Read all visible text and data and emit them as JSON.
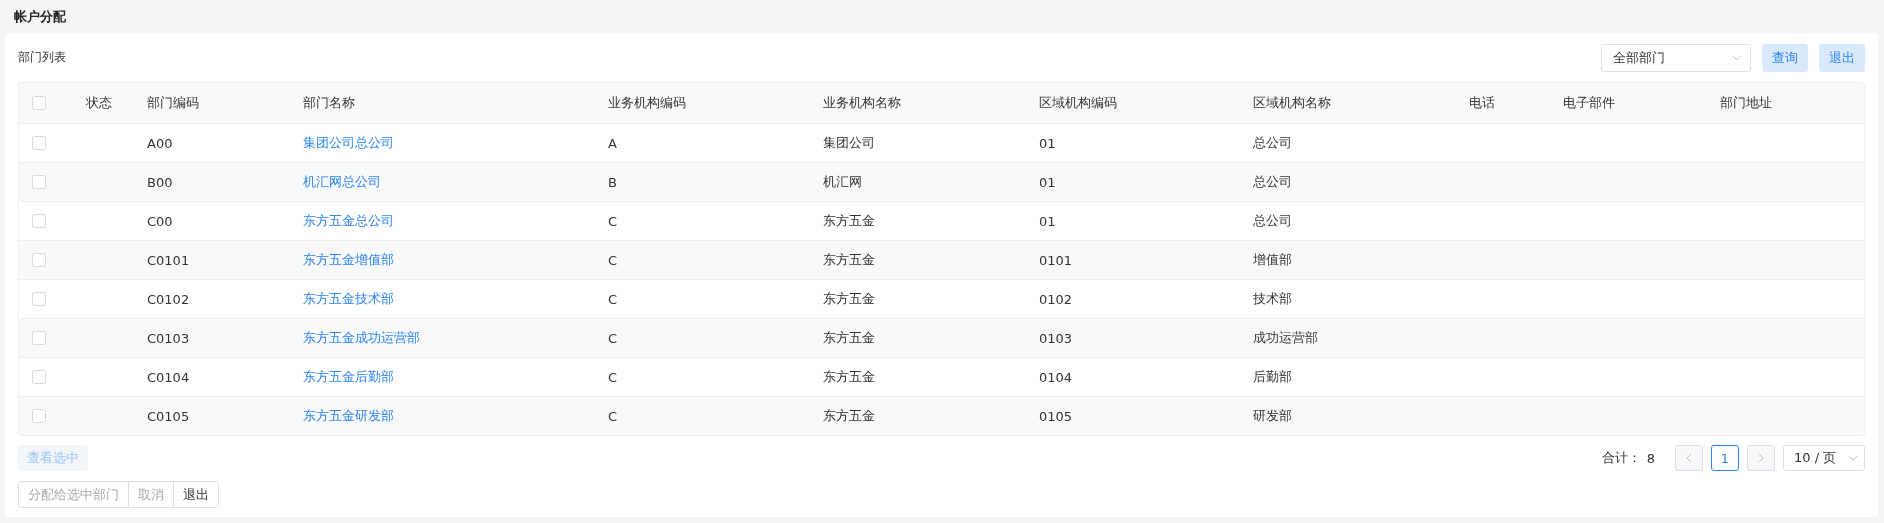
{
  "page_title": "帐户分配",
  "section_title": "部门列表",
  "department_filter": {
    "value": "全部部门"
  },
  "top_buttons": [
    {
      "label": "查询"
    },
    {
      "label": "退出"
    }
  ],
  "table": {
    "all_checked": false,
    "columns": [
      "状态",
      "部门编码",
      "部门名称",
      "业务机构编码",
      "业务机构名称",
      "区域机构编码",
      "区域机构名称",
      "电话",
      "电子部件",
      "部门地址"
    ],
    "rows": [
      {
        "checked": false,
        "cells": [
          "",
          "A00",
          "集团公司总公司",
          "A",
          "集团公司",
          "01",
          "总公司",
          "",
          "",
          ""
        ]
      },
      {
        "checked": false,
        "cells": [
          "",
          "B00",
          "机汇网总公司",
          "B",
          "机汇网",
          "01",
          "总公司",
          "",
          "",
          ""
        ]
      },
      {
        "checked": false,
        "cells": [
          "",
          "C00",
          "东方五金总公司",
          "C",
          "东方五金",
          "01",
          "总公司",
          "",
          "",
          ""
        ]
      },
      {
        "checked": false,
        "cells": [
          "",
          "C0101",
          "东方五金增值部",
          "C",
          "东方五金",
          "0101",
          "增值部",
          "",
          "",
          ""
        ]
      },
      {
        "checked": false,
        "cells": [
          "",
          "C0102",
          "东方五金技术部",
          "C",
          "东方五金",
          "0102",
          "技术部",
          "",
          "",
          ""
        ]
      },
      {
        "checked": false,
        "cells": [
          "",
          "C0103",
          "东方五金成功运营部",
          "C",
          "东方五金",
          "0103",
          "成功运营部",
          "",
          "",
          ""
        ]
      },
      {
        "checked": false,
        "cells": [
          "",
          "C0104",
          "东方五金后勤部",
          "C",
          "东方五金",
          "0104",
          "后勤部",
          "",
          "",
          ""
        ]
      },
      {
        "checked": false,
        "cells": [
          "",
          "C0105",
          "东方五金研发部",
          "C",
          "东方五金",
          "0105",
          "研发部",
          "",
          "",
          ""
        ]
      }
    ]
  },
  "view_selected_button": {
    "label": "查看选中",
    "disabled": true
  },
  "pagination": {
    "total_label": "合计：",
    "total": "8",
    "pages": [
      {
        "label": "1",
        "selected": true
      }
    ],
    "page_size": "10 / 页"
  },
  "bottom_buttons": [
    {
      "label": "分配给选中部门",
      "disabled": true
    },
    {
      "label": "取消",
      "disabled": true
    },
    {
      "label": "退出",
      "disabled": false
    }
  ]
}
